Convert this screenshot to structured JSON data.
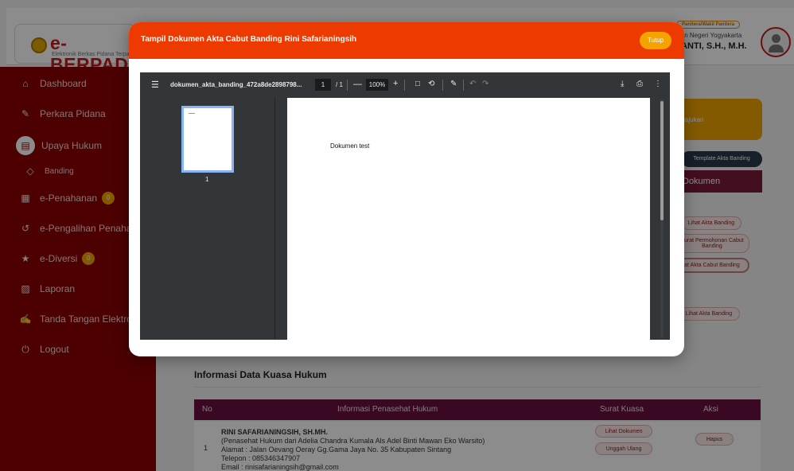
{
  "app": {
    "logo_main": "e-BERPAD",
    "logo_sub": "Elektronik Berkas Pidana Terpadu",
    "user_role": "Panitera/Wakil Panitera",
    "user_org": "Jlan Negeri Yogyakarta",
    "user_name": "JANTI, S.H., M.H."
  },
  "sidebar": {
    "items": [
      {
        "label": "Dashboard",
        "icon": "home-icon"
      },
      {
        "label": "Perkara Pidana",
        "icon": "edit-icon"
      },
      {
        "label": "Upaya Hukum",
        "icon": "document-icon"
      },
      {
        "label": "Banding",
        "icon": "diamond-icon"
      },
      {
        "label": "e-Penahanan",
        "icon": "grid-icon",
        "badge": "0"
      },
      {
        "label": "e-Pengalihan Penahanan",
        "icon": "history-icon"
      },
      {
        "label": "e-Diversi",
        "icon": "star-icon",
        "badge": "0"
      },
      {
        "label": "Laporan",
        "icon": "chart-icon"
      },
      {
        "label": "Tanda Tangan Elektronik",
        "icon": "signature-icon"
      },
      {
        "label": "Logout",
        "icon": "power-icon"
      }
    ]
  },
  "background": {
    "card_text": "ngajukan",
    "template_btn": "Template Akta Banding",
    "dokumen_head": "Dokumen",
    "pill_1": "Lihat Akta Banding",
    "pill_2": "Surat Permohonan Cabut Banding",
    "pill_3": "at Akta Cabut Banding",
    "pill_4": "Lihat Akta Banding",
    "kuasa_title": "Informasi Data Kuasa Hukum",
    "kuasa_cols": [
      "No",
      "Informasi Penasehat Hukum",
      "Surat Kuasa",
      "Aksi"
    ],
    "kuasa_row": {
      "no": "1",
      "name": "RINI SAFARIANINGSIH, SH.MH.",
      "line1": "(Penasehat Hukum dari Adelia Chandra Kumala Als Adel Binti Mawan Eko Warsito)",
      "line2": "Alamat : Jalan Oevang Oeray Gg.Gama Jaya No. 35 Kabupaten Sintang",
      "line3": "Telepon : 085346347907",
      "line4": "Email : rinisafarianingsih@gmail.com",
      "btn_lihat": "Lihat Dokumen",
      "btn_unggah": "Unggah Ulang",
      "btn_hapus": "Hapus"
    }
  },
  "modal": {
    "title": "Tampil Dokumen Akta Cabut Banding Rini Safarianingsih",
    "close_label": "Tutup",
    "accent_color": "#ec3a00"
  },
  "viewer": {
    "filename": "dokumen_akta_banding_472a8de2898798...",
    "page_current": "1",
    "page_total": "/ 1",
    "zoom": "100%",
    "thumb_label": "1",
    "doc_text": "Dokumen test"
  }
}
